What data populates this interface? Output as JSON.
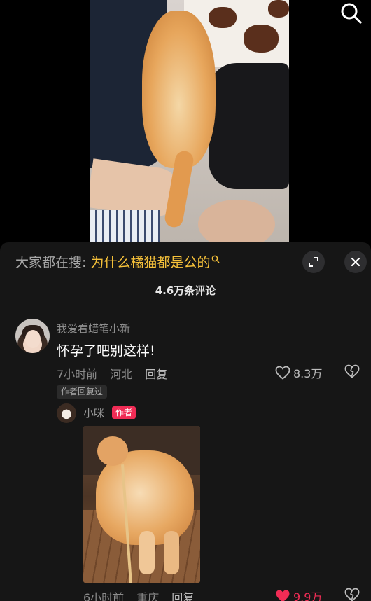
{
  "search_bar": {
    "prefix": "大家都在搜: ",
    "query": "为什么橘猫都是公的"
  },
  "comment_count": "4.6万条评论",
  "comment": {
    "username": "我爱看蜡笔小新",
    "text": "怀孕了吧别这样!",
    "time": "7小时前",
    "location": "河北",
    "reply_label": "回复",
    "likes": "8.3万",
    "author_replied_tag": "作者回复过"
  },
  "reply": {
    "username": "小咪",
    "author_badge": "作者",
    "time": "6小时前",
    "location": "重庆",
    "reply_label": "回复",
    "likes": "9.9万",
    "liked": true
  },
  "colors": {
    "accent_query": "#f7c23a",
    "like_red": "#f02c55",
    "panel_bg": "#161616"
  },
  "icons": [
    "search-icon",
    "expand-icon",
    "close-icon",
    "heart-icon",
    "broken-heart-icon"
  ]
}
